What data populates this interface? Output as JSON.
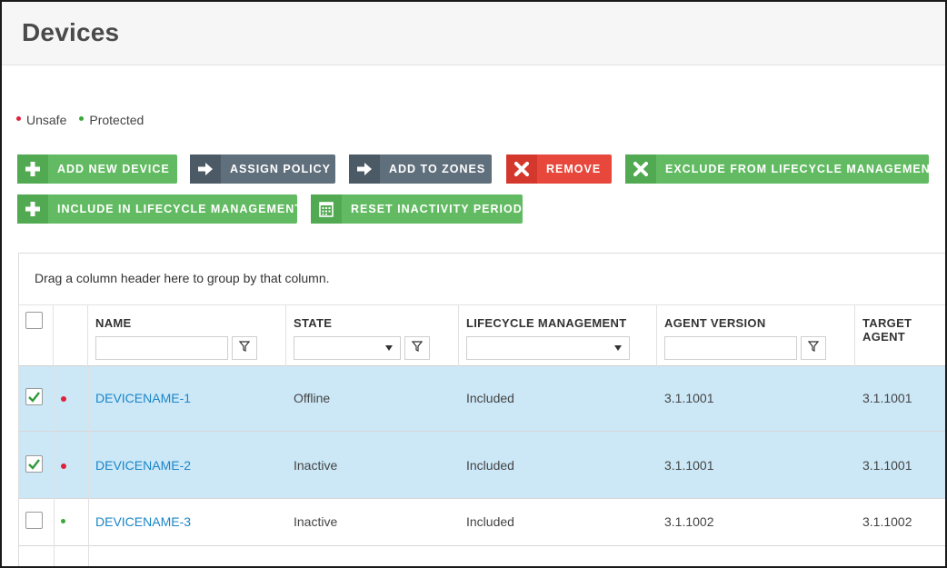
{
  "header": {
    "title": "Devices"
  },
  "legend": [
    {
      "label": "Unsafe",
      "color": "#e0223a"
    },
    {
      "label": "Protected",
      "color": "#3aa83a"
    }
  ],
  "toolbar": {
    "add_new_device": "ADD NEW DEVICE",
    "assign_policy": "ASSIGN POLICY",
    "add_to_zones": "ADD TO ZONES",
    "remove": "REMOVE",
    "exclude_lifecycle": "EXCLUDE FROM LIFECYCLE MANAGEMENT",
    "include_lifecycle": "INCLUDE IN LIFECYCLE MANAGEMENT",
    "reset_inactivity": "RESET INACTIVITY PERIOD"
  },
  "grid": {
    "group_hint": "Drag a column header here to group by that column.",
    "columns": {
      "name": "NAME",
      "state": "STATE",
      "lifecycle": "LIFECYCLE MANAGEMENT",
      "agent_version": "AGENT VERSION",
      "target_agent": "TARGET AGENT"
    },
    "filters": {
      "name": "",
      "state": "",
      "lifecycle": "",
      "agent_version": ""
    },
    "rows": [
      {
        "name": "DEVICENAME-1",
        "state": "Offline",
        "lifecycle": "Included",
        "agent_version": "3.1.1001",
        "target_agent": "3.1.1001",
        "status": "unsafe",
        "checked": true
      },
      {
        "name": "DEVICENAME-2",
        "state": "Inactive",
        "lifecycle": "Included",
        "agent_version": "3.1.1001",
        "target_agent": "3.1.1001",
        "status": "unsafe",
        "checked": true
      },
      {
        "name": "DEVICENAME-3",
        "state": "Inactive",
        "lifecycle": "Included",
        "agent_version": "3.1.1002",
        "target_agent": "3.1.1002",
        "status": "protected",
        "checked": false
      }
    ]
  },
  "icons": {
    "plus": "plus-icon",
    "arrow": "arrow-right-icon",
    "x": "x-icon",
    "calendar": "calendar-icon",
    "filter": "filter-icon",
    "check": "checkmark-icon"
  }
}
